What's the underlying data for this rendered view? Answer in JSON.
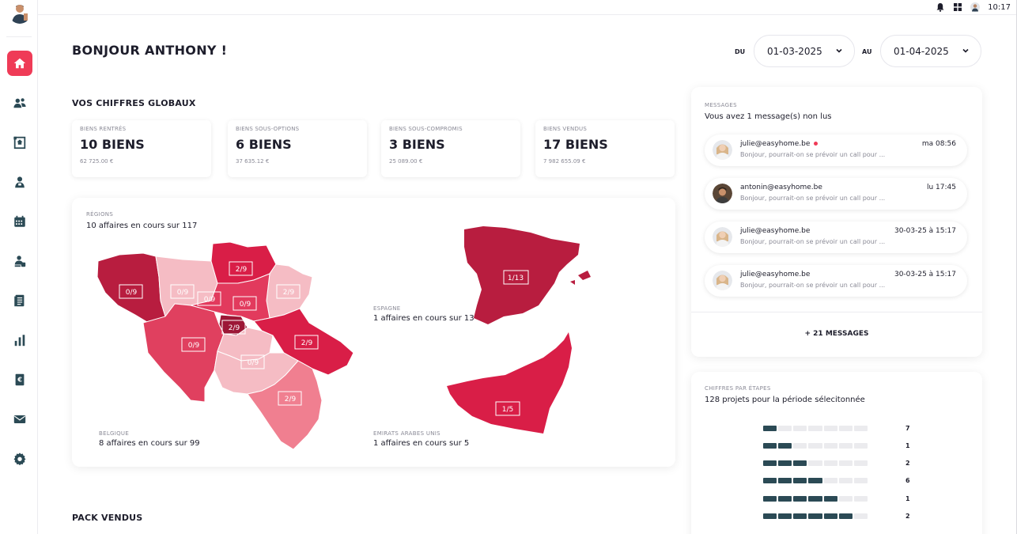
{
  "topbar": {
    "time": "10:17"
  },
  "header": {
    "greeting": "BONJOUR ANTHONY !",
    "du_label": "DU",
    "du_value": "01-03-2025",
    "au_label": "AU",
    "au_value": "01-04-2025"
  },
  "global": {
    "title": "VOS CHIFFRES GLOBAUX",
    "cards": [
      {
        "label": "BIENS RENTRÉS",
        "value": "10 BIENS",
        "amount": "62 725.00 €"
      },
      {
        "label": "BIENS SOUS-OPTIONS",
        "value": "6 BIENS",
        "amount": "37 635.12 €"
      },
      {
        "label": "BIENS SOUS-COMPROMIS",
        "value": "3 BIENS",
        "amount": "25 089.00 €"
      },
      {
        "label": "BIENS VENDUS",
        "value": "17 BIENS",
        "amount": "7 982 655.09 €"
      }
    ]
  },
  "regions": {
    "label": "RÉGIONS",
    "summary": "10 affaires en cours sur 117",
    "belgique": {
      "country": "BELGIQUE",
      "desc": "8 affaires en cours sur 99"
    },
    "espagne": {
      "country": "ESPAGNE",
      "desc": "1 affaires en cours sur 13"
    },
    "emirats": {
      "country": "EMIRATS ARABES UNIS",
      "desc": "1 affaires en cours sur 5"
    },
    "badges": [
      "0/9",
      "0/9",
      "2/9",
      "2/9",
      "0/9",
      "0/9",
      "2/9",
      "0/9",
      "2/9",
      "0/9",
      "2/9",
      "1/13",
      "1/5"
    ]
  },
  "messages": {
    "label": "MESSAGES",
    "summary": "Vous avez 1 message(s) non lus",
    "items": [
      {
        "from": "julie@easyhome.be",
        "time": "ma 08:56",
        "preview": "Bonjour, pourrait-on se prévoir un call pour ...",
        "unread": true
      },
      {
        "from": "antonin@easyhome.be",
        "time": "lu 17:45",
        "preview": "Bonjour, pourrait-on se prévoir un call pour ...",
        "unread": false
      },
      {
        "from": "julie@easyhome.be",
        "time": "30-03-25 à 15:17",
        "preview": "Bonjour, pourrait-on se prévoir un call pour ...",
        "unread": false
      },
      {
        "from": "julie@easyhome.be",
        "time": "30-03-25 à 15:17",
        "preview": "Bonjour, pourrait-on se prévoir un call pour ...",
        "unread": false
      }
    ],
    "more": "+ 21 MESSAGES"
  },
  "stages": {
    "label": "CHIFFRES PAR ÉTAPES",
    "summary": "128 projets pour la période sélecitonnée",
    "rows": [
      {
        "filled": 1,
        "count": "7"
      },
      {
        "filled": 2,
        "count": "1"
      },
      {
        "filled": 3,
        "count": "2"
      },
      {
        "filled": 4,
        "count": "6"
      },
      {
        "filled": 5,
        "count": "1"
      },
      {
        "filled": 6,
        "count": "2"
      }
    ]
  },
  "pack": {
    "title": "PACK VENDUS"
  },
  "colors": {
    "accent": "#ef3b57",
    "bar": "#2b4a55",
    "dark_red": "#b81d3f",
    "mid_red": "#d93b59",
    "light_red": "#f08a98",
    "pale_red": "#f5bcc4"
  }
}
